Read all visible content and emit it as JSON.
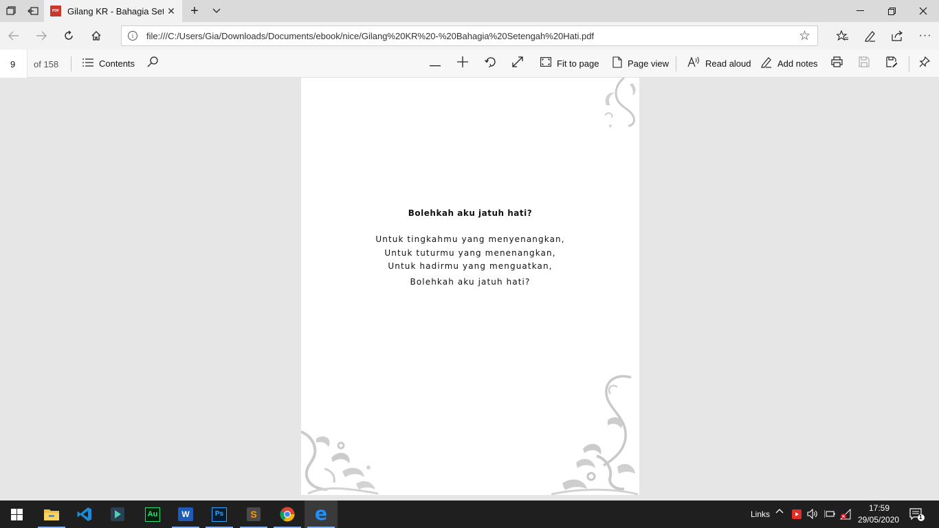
{
  "browser": {
    "tab_title": "Gilang KR - Bahagia Set",
    "tab_icon_text": "PDF",
    "address_url": "file:///C:/Users/Gia/Downloads/Documents/ebook/nice/Gilang%20KR%20-%20Bahagia%20Setengah%20Hati.pdf"
  },
  "pdf_toolbar": {
    "page_number": "9",
    "page_total": "of 158",
    "contents_label": "Contents",
    "fit_to_page_label": "Fit to page",
    "page_view_label": "Page view",
    "read_aloud_label": "Read aloud",
    "add_notes_label": "Add notes"
  },
  "document": {
    "title": "Bolehkah aku jatuh hati?",
    "lines": [
      "Untuk tingkahmu yang menyenangkan,",
      "Untuk tuturmu yang menenangkan,",
      "Untuk hadirmu yang menguatkan,",
      "Bolehkah aku jatuh hati?"
    ]
  },
  "taskbar": {
    "links_label": "Links",
    "time": "17:59",
    "date": "29/05/2020",
    "notification_count": "1",
    "apps": [
      "windows-start",
      "file-explorer",
      "visual-studio-code",
      "filmora",
      "adobe-audition",
      "microsoft-word",
      "adobe-photoshop",
      "sublime-text",
      "google-chrome",
      "microsoft-edge"
    ],
    "audition_label": "Au",
    "word_label": "W",
    "photoshop_label": "Ps",
    "sublime_label": "S",
    "edge_label": "e"
  },
  "colors": {
    "pdf_icon": "#c8382f",
    "edge_blue": "#0078d7",
    "taskbar_bg": "#1f1f1f",
    "active_underline": "#8ab4f8"
  }
}
